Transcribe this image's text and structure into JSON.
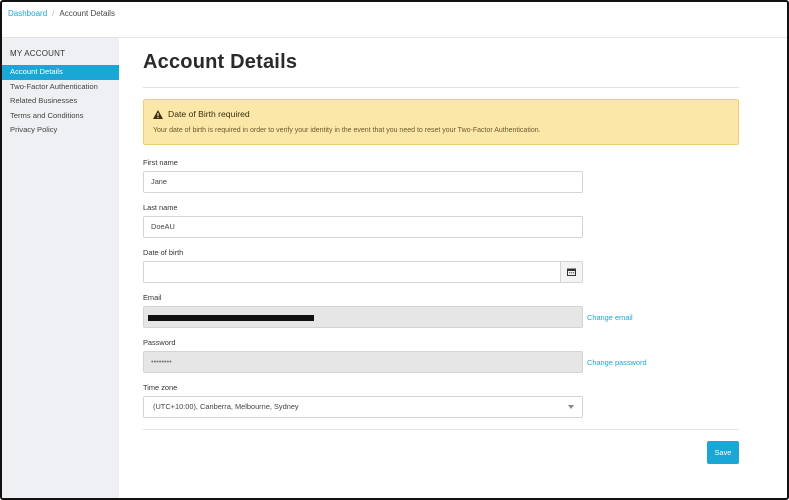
{
  "breadcrumb": {
    "home": "Dashboard",
    "separator": "/",
    "current": "Account Details"
  },
  "sidebar": {
    "heading": "MY ACCOUNT",
    "items": [
      {
        "label": "Account Details"
      },
      {
        "label": "Two-Factor Authentication"
      },
      {
        "label": "Related Businesses"
      },
      {
        "label": "Terms and Conditions"
      },
      {
        "label": "Privacy Policy"
      }
    ]
  },
  "main": {
    "title": "Account Details",
    "alert": {
      "title": "Date of Birth required",
      "text": "Your date of birth is required in order to verify your identity in the event that you need to reset your Two-Factor Authentication."
    },
    "first_name": {
      "label": "First name",
      "value": "Jane"
    },
    "last_name": {
      "label": "Last name",
      "value": "DoeAU"
    },
    "dob": {
      "label": "Date of birth",
      "value": ""
    },
    "email": {
      "label": "Email",
      "link": "Change email"
    },
    "password": {
      "label": "Password",
      "value": "••••••••",
      "link": "Change password"
    },
    "timezone": {
      "label": "Time zone",
      "value": "(UTC+10:00), Canberra, Melbourne, Sydney"
    },
    "save_label": "Save"
  },
  "colors": {
    "accent": "#1aa7d6",
    "alert_bg": "#fbe7a8",
    "sidebar_bg": "#eef0f4"
  }
}
